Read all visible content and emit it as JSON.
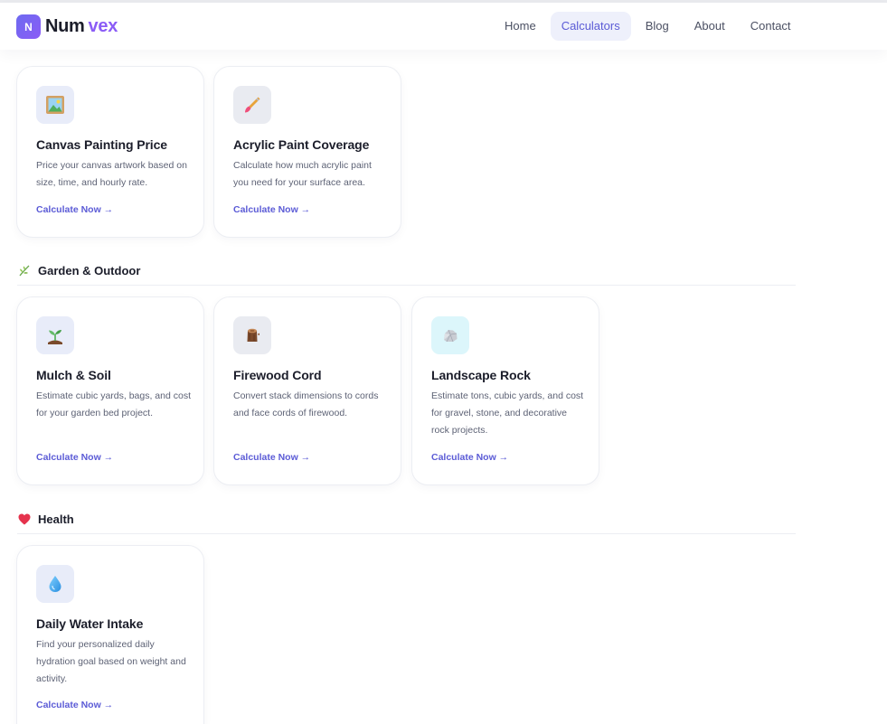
{
  "brand": {
    "badge": "N",
    "name_part1": "Num",
    "name_part2": "vex"
  },
  "nav": [
    {
      "label": "Home",
      "active": false
    },
    {
      "label": "Calculators",
      "active": true
    },
    {
      "label": "Blog",
      "active": false
    },
    {
      "label": "About",
      "active": false
    },
    {
      "label": "Contact",
      "active": false
    }
  ],
  "cards_art": [
    {
      "title": "Canvas Painting Price",
      "description": "Price your canvas artwork based on size, time, and hourly rate.",
      "cta": "Calculate Now →",
      "icon": "framed-picture-icon"
    },
    {
      "title": "Acrylic Paint Coverage",
      "description": "Calculate how much acrylic paint you need for your surface area.",
      "cta": "Calculate Now →",
      "icon": "paintbrush-icon"
    }
  ],
  "sections": [
    {
      "title": "Garden & Outdoor",
      "icon": "herb-icon"
    },
    {
      "title": "Health",
      "icon": "heart-icon"
    }
  ],
  "cards_garden": [
    {
      "title": "Mulch & Soil",
      "description": "Estimate cubic yards, bags, and cost for your garden bed project.",
      "cta": "Calculate Now →",
      "icon": "seedling-icon"
    },
    {
      "title": "Firewood Cord",
      "description": "Convert stack dimensions to cords and face cords of firewood.",
      "cta": "Calculate Now →",
      "icon": "wood-log-icon"
    },
    {
      "title": "Landscape Rock",
      "description": "Estimate tons, cubic yards, and cost for gravel, stone, and decorative rock projects.",
      "cta": "Calculate Now →",
      "icon": "rock-icon"
    }
  ],
  "cards_health": [
    {
      "title": "Daily Water Intake",
      "description": "Find your personalized daily hydration goal based on weight and activity.",
      "cta": "Calculate Now →",
      "icon": "droplet-icon"
    }
  ],
  "colors": {
    "accent": "#5b5bd6",
    "brand_purple": "#8b5cf6",
    "text": "#1b1d2a",
    "muted": "#5d6275"
  }
}
